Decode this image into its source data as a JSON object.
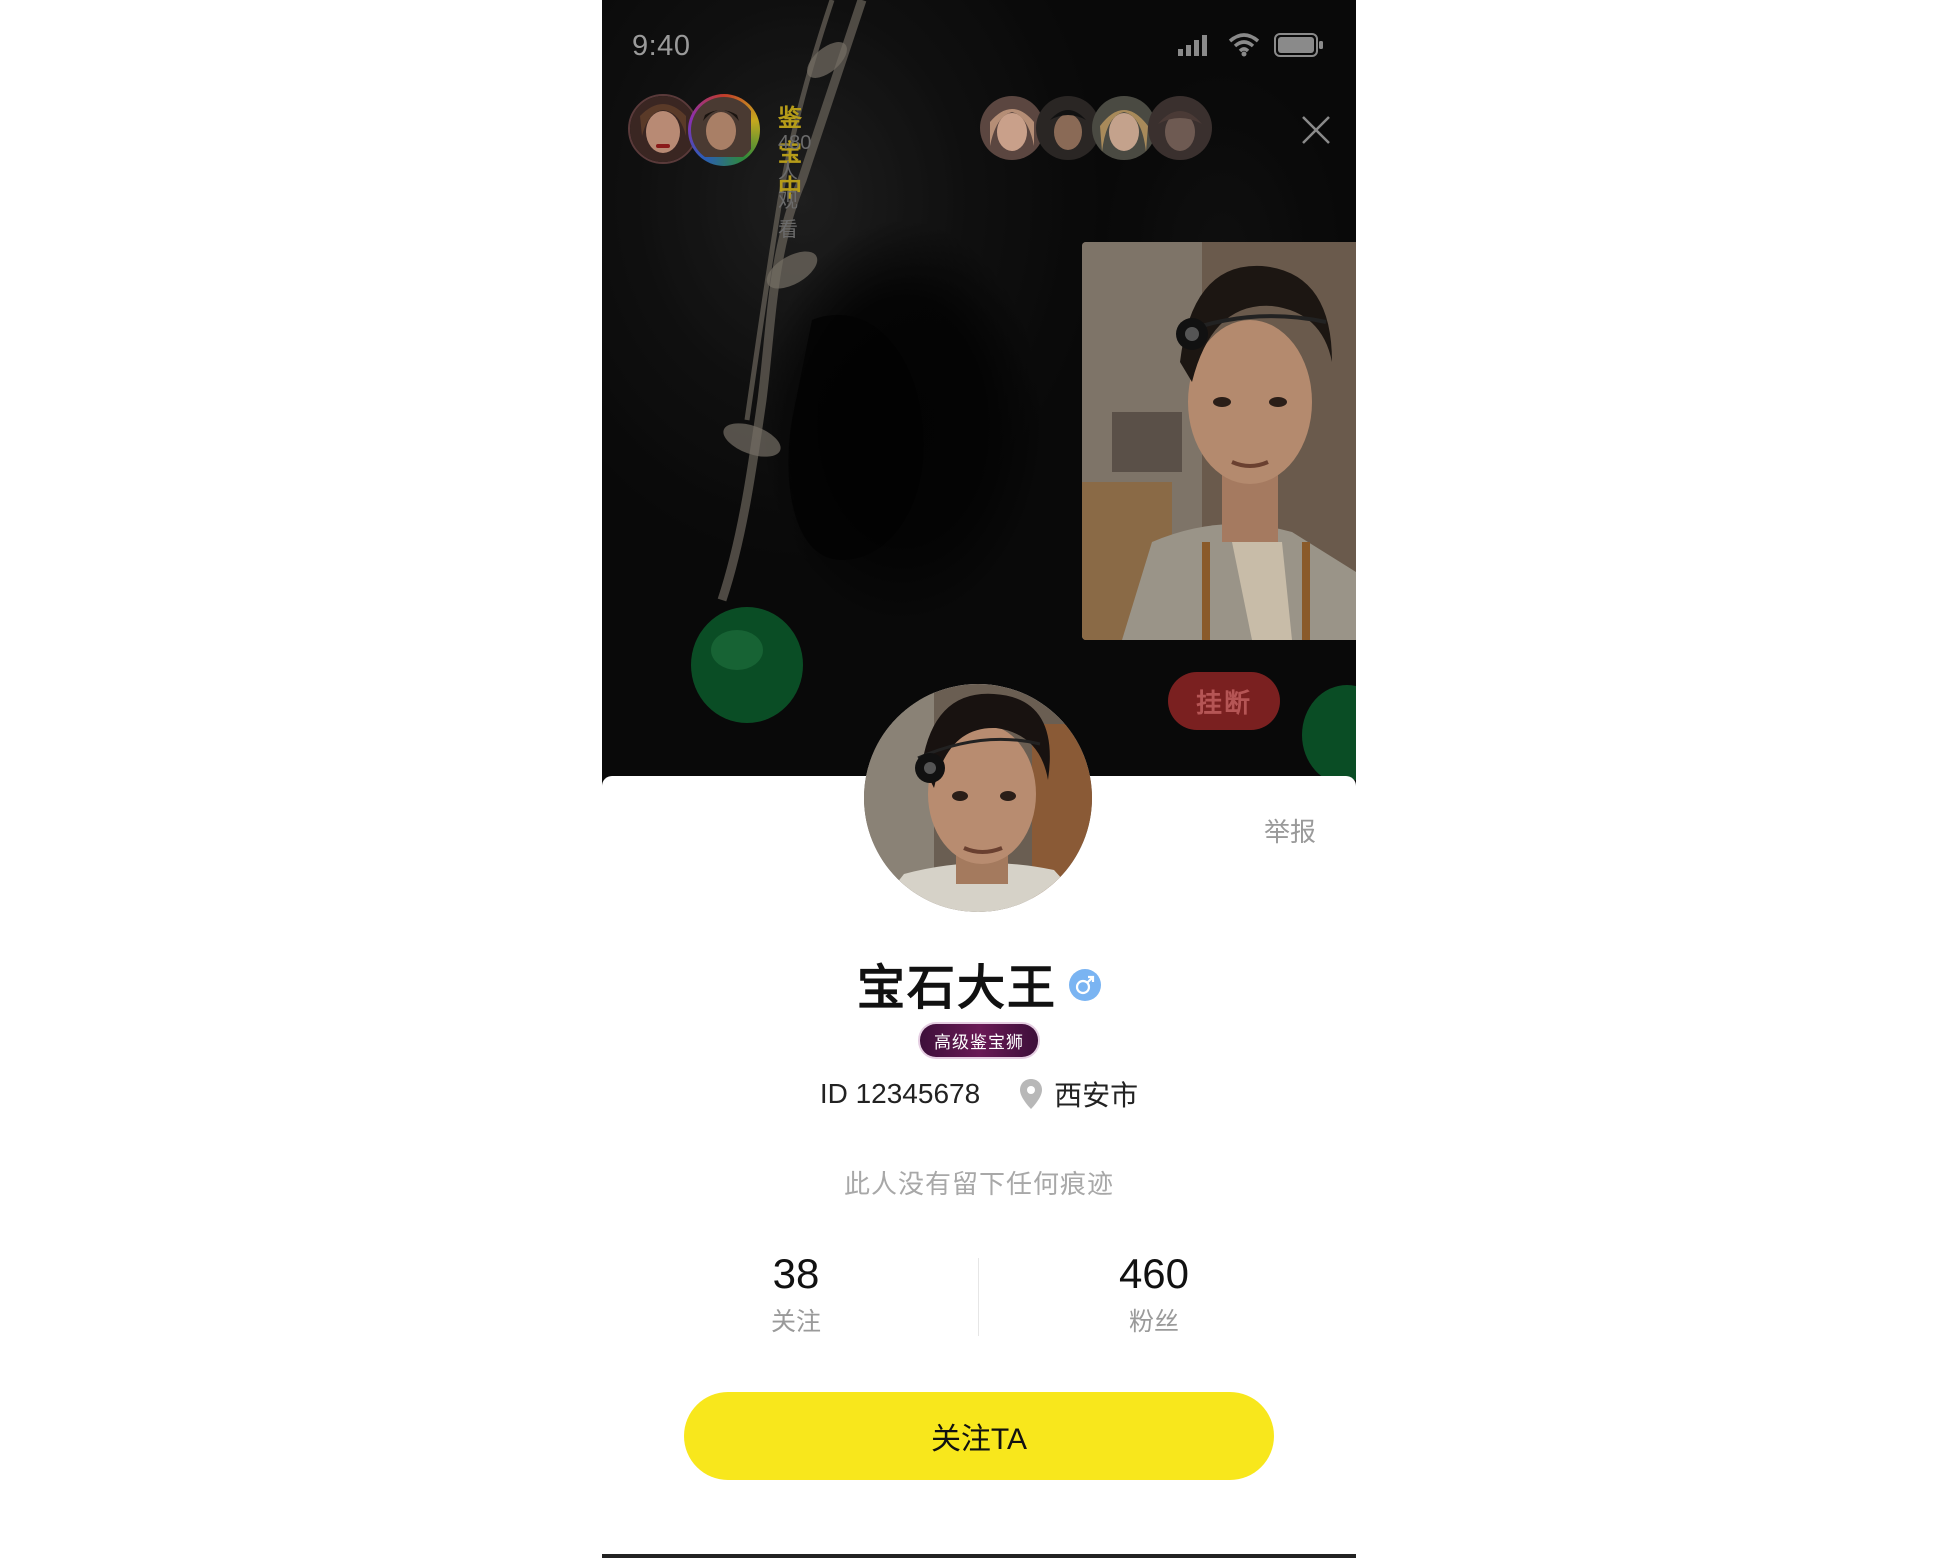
{
  "status_bar": {
    "time": "9:40"
  },
  "host": {
    "status": "鉴宝中",
    "viewers": "480人观看"
  },
  "video": {
    "hangup_label": "挂断"
  },
  "profile": {
    "report_label": "举报",
    "name": "宝石大王",
    "badge": "高级鉴宝狮",
    "id": "ID 12345678",
    "location": "西安市",
    "bio": "此人没有留下任何痕迹",
    "stats": [
      {
        "value": "38",
        "label": "关注"
      },
      {
        "value": "460",
        "label": "粉丝"
      }
    ],
    "follow_label": "关注TA"
  },
  "colors": {
    "accent_yellow": "#f8e71c",
    "hangup_red": "#7a2020",
    "gender_blue": "#7ab4f2",
    "badge_purple": "#5a1550"
  }
}
